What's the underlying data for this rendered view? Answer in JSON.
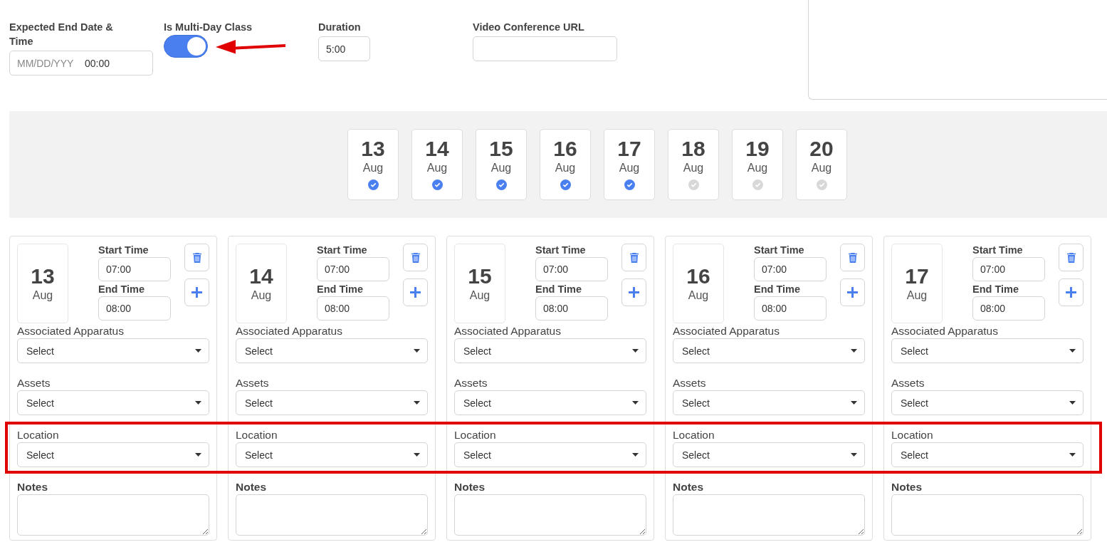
{
  "header": {
    "end_date": {
      "label": "Expected End Date & Time",
      "placeholder": "MM/DD/YYY",
      "time": "00:00"
    },
    "multi_day": {
      "label": "Is Multi-Day Class",
      "on": true
    },
    "duration": {
      "label": "Duration",
      "value": "5:00"
    },
    "video_url": {
      "label": "Video Conference URL"
    }
  },
  "dates": [
    {
      "day": "13",
      "month": "Aug",
      "selected": true
    },
    {
      "day": "14",
      "month": "Aug",
      "selected": true
    },
    {
      "day": "15",
      "month": "Aug",
      "selected": true
    },
    {
      "day": "16",
      "month": "Aug",
      "selected": true
    },
    {
      "day": "17",
      "month": "Aug",
      "selected": true
    },
    {
      "day": "18",
      "month": "Aug",
      "selected": false
    },
    {
      "day": "19",
      "month": "Aug",
      "selected": false
    },
    {
      "day": "20",
      "month": "Aug",
      "selected": false
    }
  ],
  "sessions": [
    {
      "day": "13",
      "month": "Aug",
      "start_label": "Start Time",
      "start": "07:00",
      "end_label": "End Time",
      "end": "08:00",
      "apparatus_label": "Associated Apparatus",
      "apparatus": "Select",
      "assets_label": "Assets",
      "assets": "Select",
      "location_label": "Location",
      "location": "Select",
      "notes_label": "Notes"
    },
    {
      "day": "14",
      "month": "Aug",
      "start_label": "Start Time",
      "start": "07:00",
      "end_label": "End Time",
      "end": "08:00",
      "apparatus_label": "Associated Apparatus",
      "apparatus": "Select",
      "assets_label": "Assets",
      "assets": "Select",
      "location_label": "Location",
      "location": "Select",
      "notes_label": "Notes"
    },
    {
      "day": "15",
      "month": "Aug",
      "start_label": "Start Time",
      "start": "07:00",
      "end_label": "End Time",
      "end": "08:00",
      "apparatus_label": "Associated Apparatus",
      "apparatus": "Select",
      "assets_label": "Assets",
      "assets": "Select",
      "location_label": "Location",
      "location": "Select",
      "notes_label": "Notes"
    },
    {
      "day": "16",
      "month": "Aug",
      "start_label": "Start Time",
      "start": "07:00",
      "end_label": "End Time",
      "end": "08:00",
      "apparatus_label": "Associated Apparatus",
      "apparatus": "Select",
      "assets_label": "Assets",
      "assets": "Select",
      "location_label": "Location",
      "location": "Select",
      "notes_label": "Notes"
    },
    {
      "day": "17",
      "month": "Aug",
      "start_label": "Start Time",
      "start": "07:00",
      "end_label": "End Time",
      "end": "08:00",
      "apparatus_label": "Associated Apparatus",
      "apparatus": "Select",
      "assets_label": "Assets",
      "assets": "Select",
      "location_label": "Location",
      "location": "Select",
      "notes_label": "Notes"
    }
  ]
}
